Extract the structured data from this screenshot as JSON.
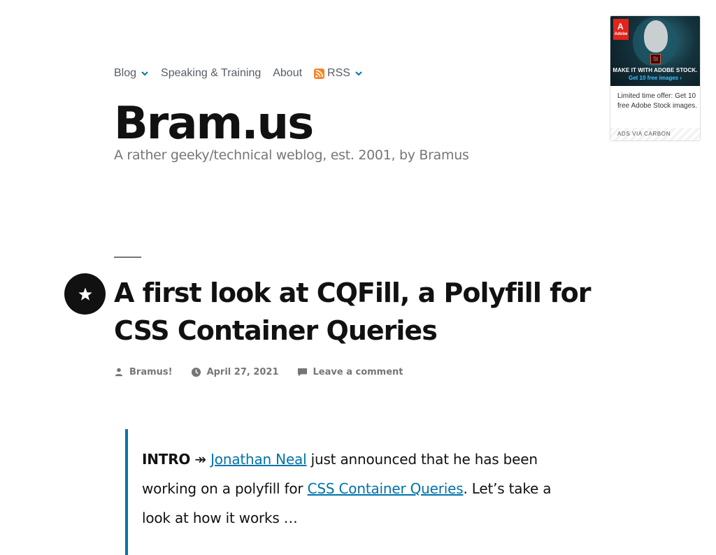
{
  "nav": {
    "items": [
      {
        "label": "Blog",
        "has_dropdown": true
      },
      {
        "label": "Speaking & Training",
        "has_dropdown": false
      },
      {
        "label": "About",
        "has_dropdown": false
      },
      {
        "label": "RSS",
        "has_dropdown": true,
        "icon": "rss-icon"
      }
    ]
  },
  "site": {
    "title": "Bram.us",
    "description": "A rather geeky/technical weblog, est. 2001, by Bramus"
  },
  "ad": {
    "logo_text": "Adobe",
    "badge_text": "St",
    "headline": "MAKE IT WITH ADOBE STOCK.",
    "cta": "Get 10 free images ›",
    "text": "Limited time offer: Get 10 free Adobe Stock images.",
    "via": "ADS VIA CARBON"
  },
  "post": {
    "sticky_icon": "star-icon",
    "title": "A first look at CQFill, a Polyfill for CSS Container Queries",
    "meta": {
      "author": "Bramus!",
      "date": "April 27, 2021",
      "comments": "Leave a comment"
    },
    "intro": {
      "label": "INTRO",
      "arrow": " ↠ ",
      "link1": "Jonathan Neal",
      "text1": " just announced that he has been working on a polyfill for ",
      "link2": "CSS Container Queries",
      "text2": ". Let’s take a look at how it works …"
    }
  },
  "colors": {
    "accent": "#0073aa",
    "text": "#111111",
    "muted": "#767676",
    "rss": "#f78422"
  }
}
